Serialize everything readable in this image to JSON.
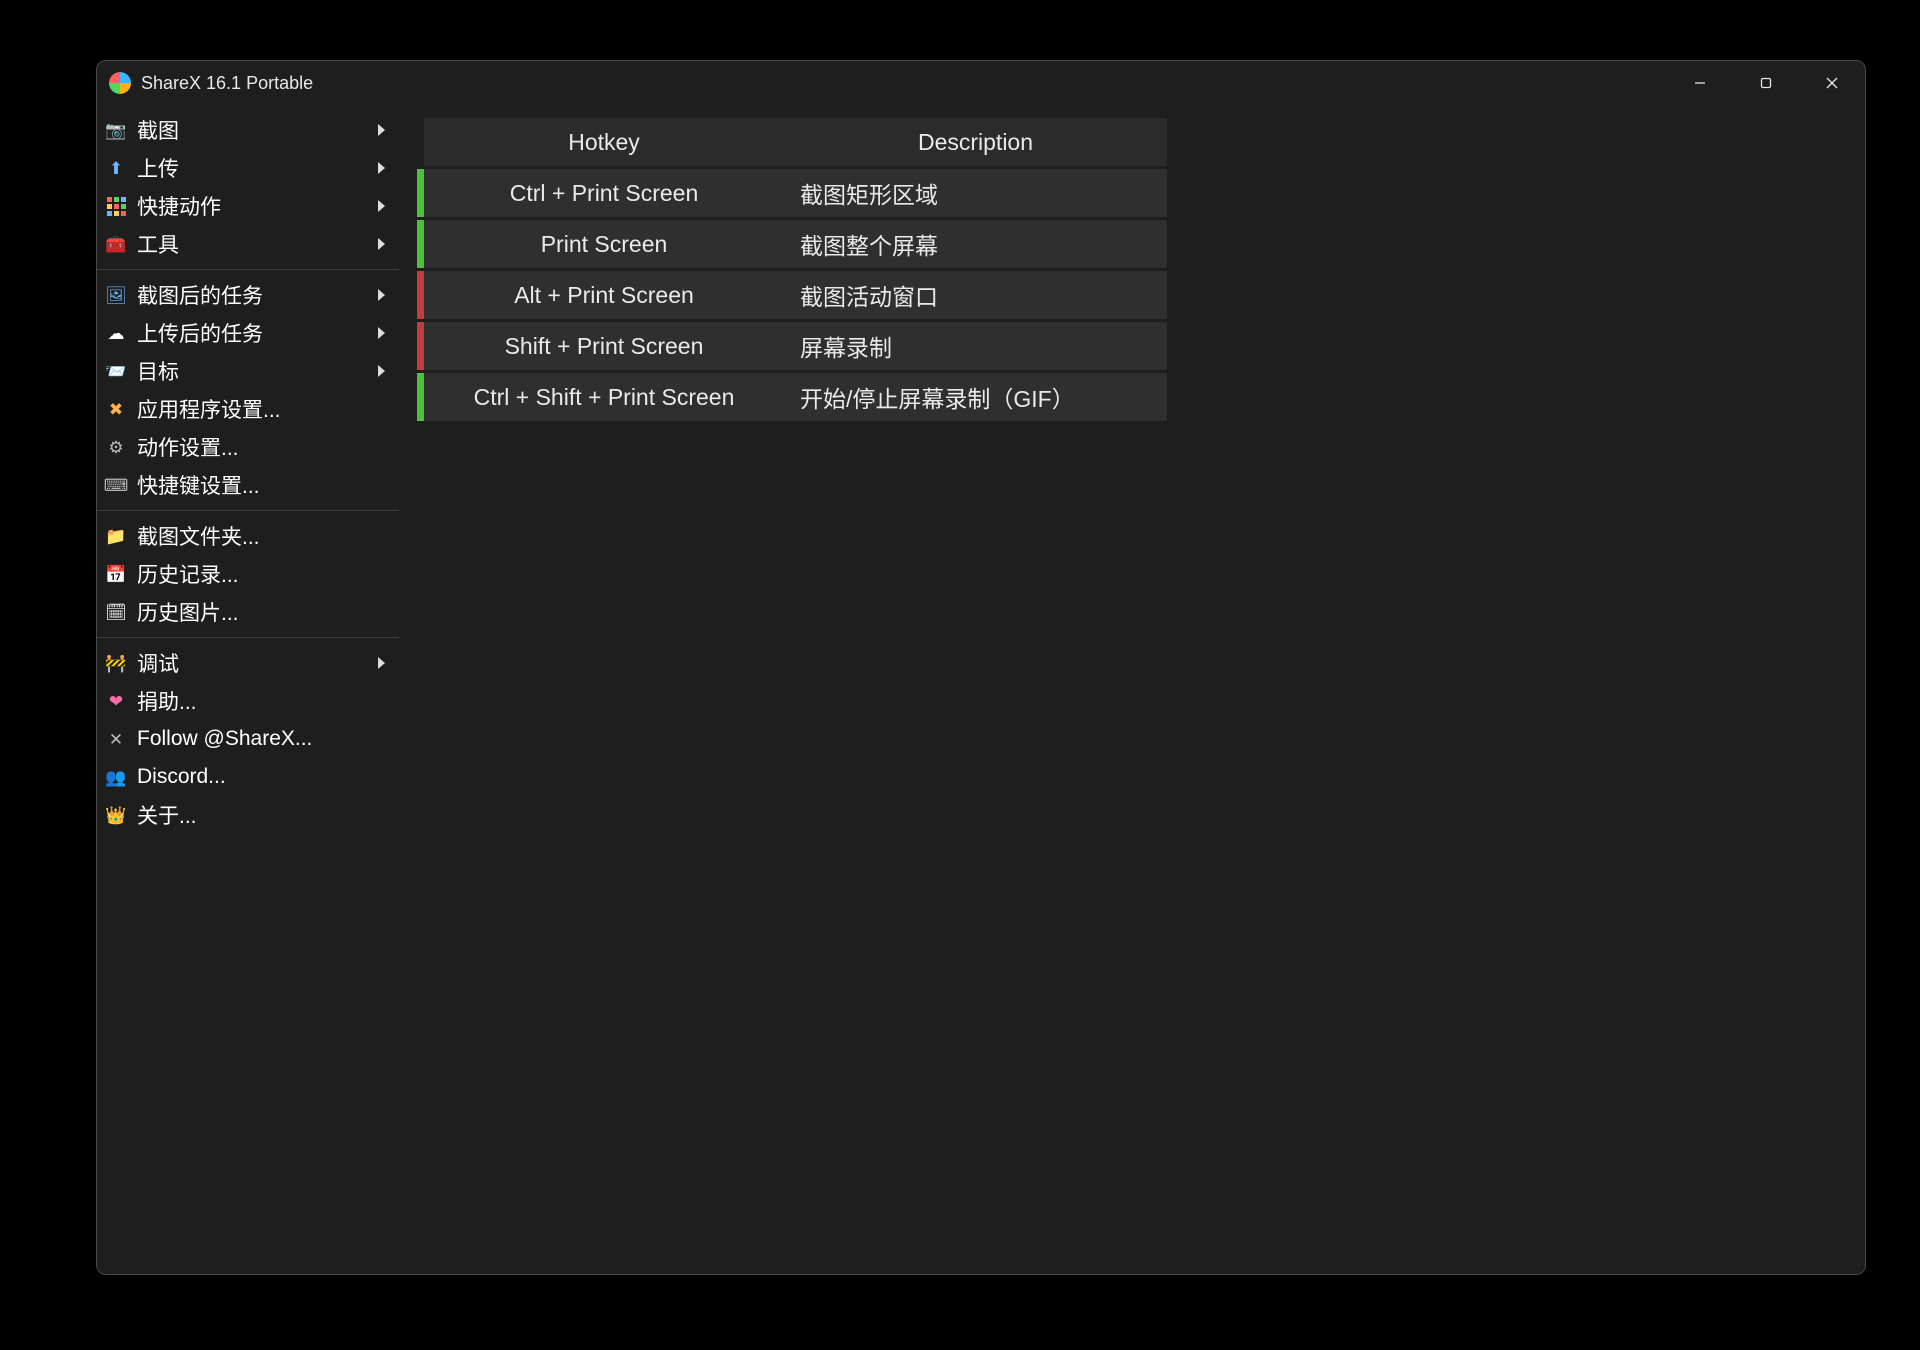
{
  "window": {
    "title": "ShareX 16.1 Portable"
  },
  "sidebar": {
    "groups": [
      [
        {
          "label": "截图",
          "icon": "📷",
          "arrow": true,
          "name": "screenshot"
        },
        {
          "label": "上传",
          "icon": "⬆",
          "arrow": true,
          "name": "upload",
          "iconClass": "i-blue"
        },
        {
          "label": "快捷动作",
          "icon": "grid",
          "arrow": true,
          "name": "quick-actions"
        },
        {
          "label": "工具",
          "icon": "🧰",
          "arrow": true,
          "name": "tools",
          "iconClass": "i-red"
        }
      ],
      [
        {
          "label": "截图后的任务",
          "icon": "🖼",
          "arrow": true,
          "name": "after-capture",
          "iconClass": "i-blue"
        },
        {
          "label": "上传后的任务",
          "icon": "☁",
          "arrow": true,
          "name": "after-upload"
        },
        {
          "label": "目标",
          "icon": "📨",
          "arrow": true,
          "name": "destinations",
          "iconClass": "i-blue"
        },
        {
          "label": "应用程序设置...",
          "icon": "✖",
          "arrow": false,
          "name": "app-settings",
          "iconClass": "i-orange"
        },
        {
          "label": "动作设置...",
          "icon": "⚙",
          "arrow": false,
          "name": "task-settings",
          "iconClass": "i-gray"
        },
        {
          "label": "快捷键设置...",
          "icon": "⌨",
          "arrow": false,
          "name": "hotkey-settings",
          "iconClass": "i-gray"
        }
      ],
      [
        {
          "label": "截图文件夹...",
          "icon": "📁",
          "arrow": false,
          "name": "screenshots-folder",
          "iconClass": "i-yellow"
        },
        {
          "label": "历史记录...",
          "icon": "📅",
          "arrow": false,
          "name": "history"
        },
        {
          "label": "历史图片...",
          "icon": "🗓",
          "arrow": false,
          "name": "image-history"
        }
      ],
      [
        {
          "label": "调试",
          "icon": "🚧",
          "arrow": true,
          "name": "debug",
          "iconClass": "i-orange"
        },
        {
          "label": "捐助...",
          "icon": "❤",
          "arrow": false,
          "name": "donate",
          "iconClass": "i-pink"
        },
        {
          "label": "Follow @ShareX...",
          "icon": "✕",
          "arrow": false,
          "name": "follow-twitter",
          "iconClass": "i-gray"
        },
        {
          "label": "Discord...",
          "icon": "👥",
          "arrow": false,
          "name": "discord",
          "iconClass": "i-gray"
        },
        {
          "label": "关于...",
          "icon": "👑",
          "arrow": false,
          "name": "about",
          "iconClass": "i-yellow"
        }
      ]
    ]
  },
  "table": {
    "headers": {
      "hotkey": "Hotkey",
      "description": "Description"
    },
    "rows": [
      {
        "status": "green",
        "hotkey": "Ctrl + Print Screen",
        "desc": "截图矩形区域"
      },
      {
        "status": "green",
        "hotkey": "Print Screen",
        "desc": "截图整个屏幕"
      },
      {
        "status": "red",
        "hotkey": "Alt + Print Screen",
        "desc": "截图活动窗口"
      },
      {
        "status": "red",
        "hotkey": "Shift + Print Screen",
        "desc": "屏幕录制"
      },
      {
        "status": "green",
        "hotkey": "Ctrl + Shift + Print Screen",
        "desc": "开始/停止屏幕录制（GIF）"
      }
    ]
  }
}
